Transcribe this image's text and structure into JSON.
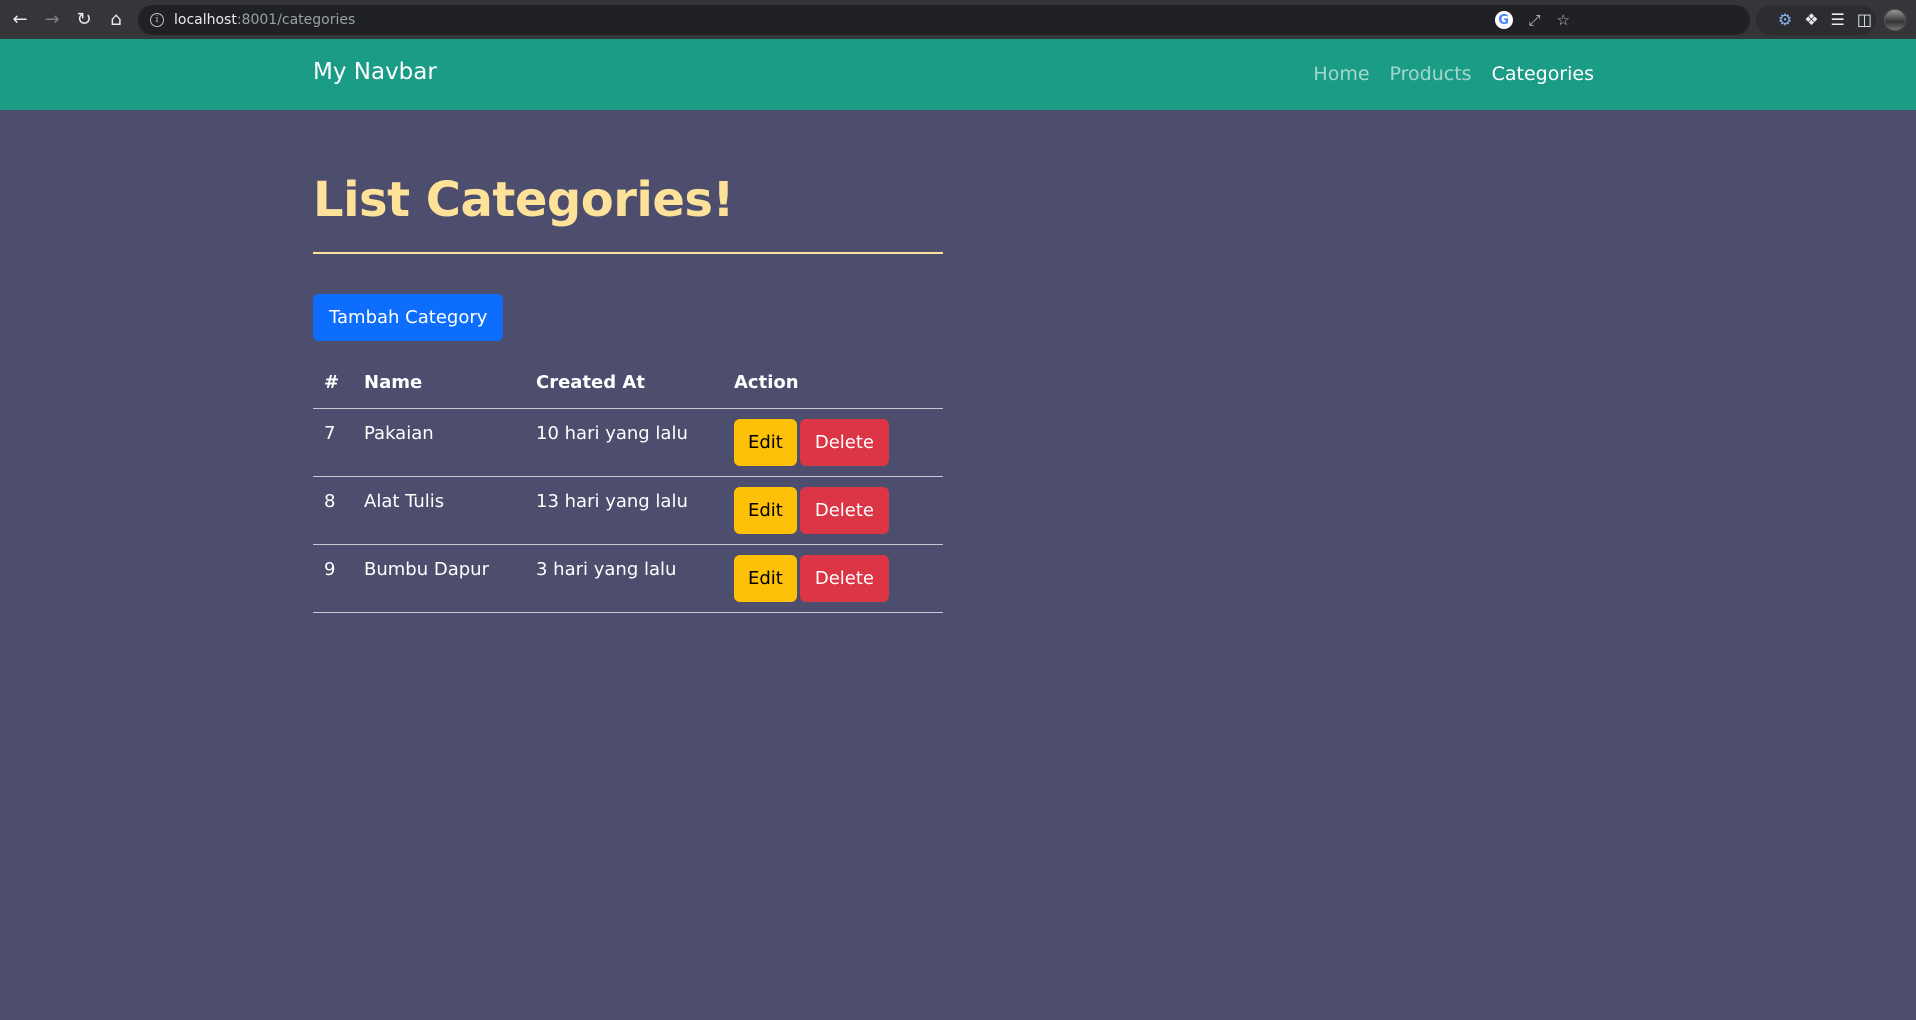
{
  "browser": {
    "url_host": "localhost",
    "url_path": ":8001/categories"
  },
  "navbar": {
    "brand": "My Navbar",
    "links": [
      {
        "label": "Home",
        "active": false
      },
      {
        "label": "Products",
        "active": false
      },
      {
        "label": "Categories",
        "active": true
      }
    ]
  },
  "main": {
    "title": "List Categories!",
    "add_button": "Tambah Category",
    "table": {
      "headers": [
        "#",
        "Name",
        "Created At",
        "Action"
      ],
      "rows": [
        {
          "id": "7",
          "name": "Pakaian",
          "created_at": "10 hari yang lalu"
        },
        {
          "id": "8",
          "name": "Alat Tulis",
          "created_at": "13 hari yang lalu"
        },
        {
          "id": "9",
          "name": "Bumbu Dapur",
          "created_at": "3 hari yang lalu"
        }
      ],
      "edit_label": "Edit",
      "delete_label": "Delete"
    }
  },
  "colors": {
    "background": "#4d4d6e",
    "navbar": "#1a9c86",
    "title": "#ffe29a",
    "primary": "#0d6efd",
    "warning": "#ffc107",
    "danger": "#dc3545"
  }
}
